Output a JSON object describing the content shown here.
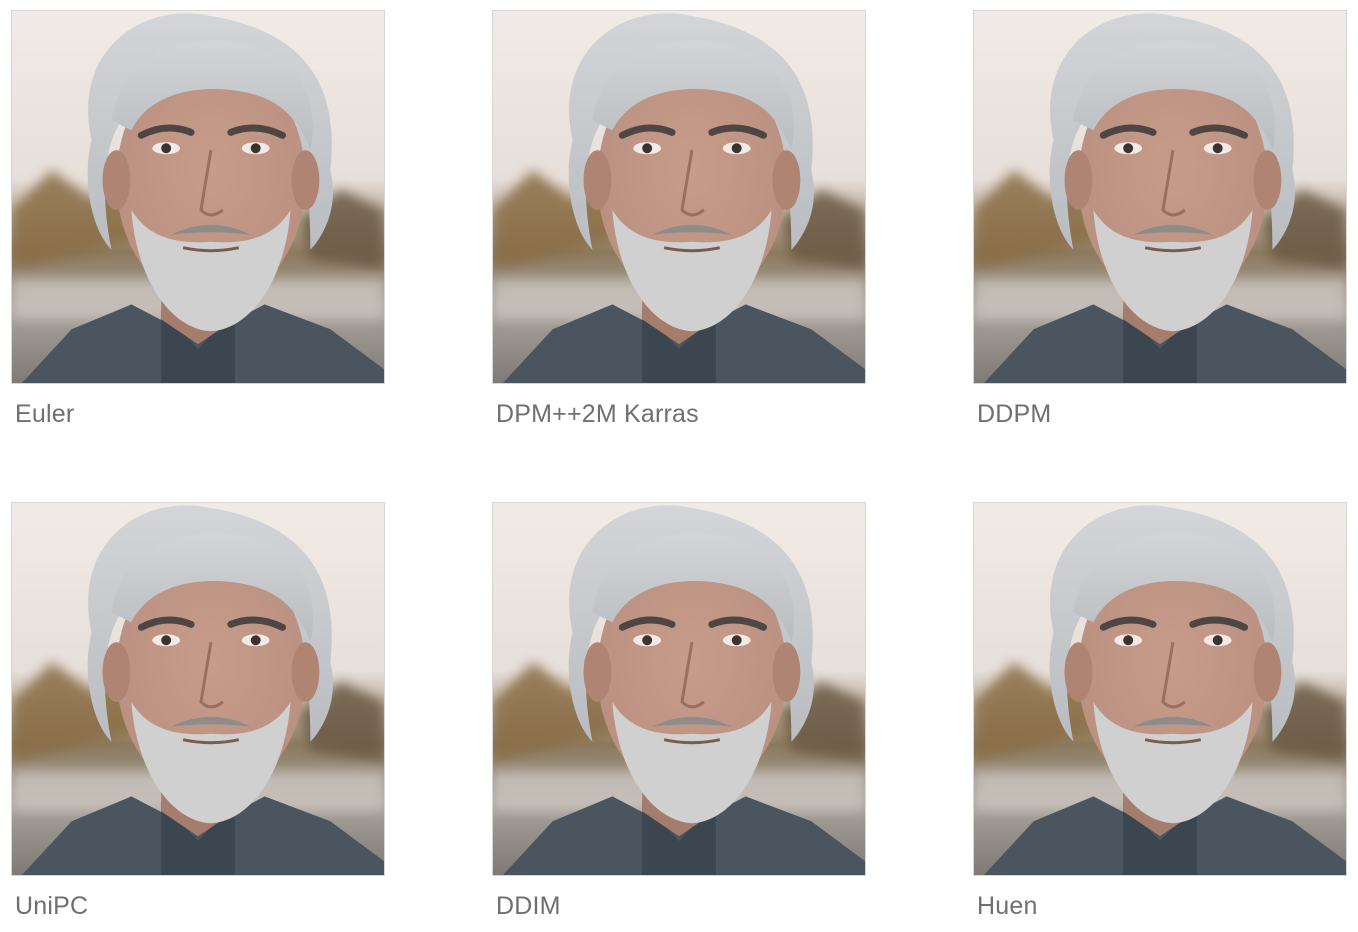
{
  "gallery": {
    "items": [
      {
        "label": "Euler",
        "icon": "portrait-photo"
      },
      {
        "label": "DPM++2M Karras",
        "icon": "portrait-photo"
      },
      {
        "label": "DDPM",
        "icon": "portrait-photo"
      },
      {
        "label": "UniPC",
        "icon": "portrait-photo"
      },
      {
        "label": "DDIM",
        "icon": "portrait-photo"
      },
      {
        "label": "Huen",
        "icon": "portrait-photo"
      }
    ]
  },
  "colors": {
    "caption": "#6f6f6f",
    "background": "#ffffff",
    "sky": "#e7dfd9",
    "hair": "#b9bcc0",
    "skin": "#b98f80",
    "beard": "#cfd0cf",
    "jacket": "#4b5560"
  }
}
